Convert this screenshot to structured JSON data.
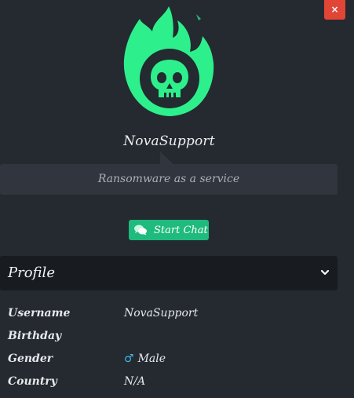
{
  "window": {
    "close_label": "×"
  },
  "user": {
    "display_name": "NovaSupport",
    "bio": "Ransomware as a service",
    "avatar_icon": "flaming-skull-icon"
  },
  "actions": {
    "start_chat_label": "Start Chat",
    "start_chat_icon": "chat-bubbles-icon"
  },
  "profile": {
    "section_title": "Profile",
    "toggle_icon": "chevron-down-icon",
    "fields": [
      {
        "label": "Username",
        "value": "NovaSupport"
      },
      {
        "label": "Birthday",
        "value": ""
      },
      {
        "label": "Gender",
        "value": "Male",
        "icon_glyph": "♂",
        "icon": "male-icon"
      },
      {
        "label": "Country",
        "value": "N/A"
      }
    ]
  },
  "colors": {
    "background": "#252a31",
    "accent_green": "#1fba7d",
    "avatar_green": "#2df08c",
    "close_red": "#e14535",
    "male_blue": "#3db8e6"
  }
}
